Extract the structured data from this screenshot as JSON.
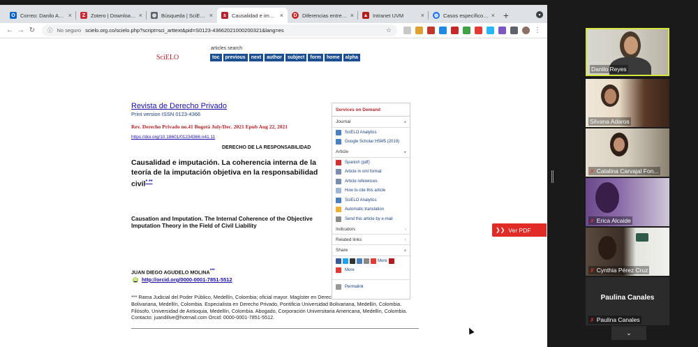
{
  "tabs": [
    {
      "title": "Correo: Danilo Andrés Reyes",
      "icon_color": "#0a64c8",
      "icon": "outlook-icon"
    },
    {
      "title": "Zotero | Downloads",
      "icon_color": "#cc2936",
      "icon": "zotero-icon"
    },
    {
      "title": "Búsqueda | SciELO",
      "icon_color": "#5f6368",
      "icon": "globe-icon"
    },
    {
      "title": "Causalidad e imputación",
      "icon_color": "#b4232a",
      "icon": "scielo-icon",
      "active": true
    },
    {
      "title": "Diferencias entre el dolo",
      "icon_color": "#c62828",
      "icon": "d-icon"
    },
    {
      "title": "Intranet UVM",
      "icon_color": "#b71c1c",
      "icon": "uvm-icon"
    },
    {
      "title": "Casos específicos de",
      "icon_color": "#1a73e8",
      "icon": "globe-icon"
    }
  ],
  "close_glyph": "×",
  "new_tab_glyph": "+",
  "address": {
    "security": "No seguro",
    "url": "scielo.org.co/scielo.php?script=sci_arttext&pid=S0123-43662021000200321&lang=es"
  },
  "page": {
    "logo": "SciELO",
    "nav_label": "articles search",
    "nav_items": [
      "toc",
      "previous",
      "next",
      "author",
      "subject",
      "form",
      "home",
      "alpha"
    ],
    "journal": "Revista de Derecho Privado",
    "issn": "Print version ISSN 0123-4366",
    "issue": "Rev. Derecho Privado  no.41 Bogotá July/Dec. 2021  Epub Aug 22, 2021",
    "doi": "https://doi.org/10.18601/01234366.n41.11",
    "section": "DERECHO DE LA RESPONSABILIDAD",
    "title_es": "Causalidad e imputación. La coherencia interna de la teoría de la imputación objetiva en la responsabilidad civil",
    "title_es_marks": "* **",
    "title_en": "Causation and Imputation. The Internal Coherence of the Objective Imputation Theory in the Field of Civil Liability",
    "author": "JUAN DIEGO AGUDELO MOLINA",
    "author_marks": "***",
    "orcid": "http://orcid.org/0000-0001-7851-5512",
    "affiliation": "*** Rama Judicial del Poder Público, Medellín, Colombia; oficial mayor. Magíster en Derecho, Pontificia Universidad Bolivariana, Medellín, Colombia. Especialista en Derecho Privado, Pontificia Universidad Bolivariana, Medellín, Colombia. Filósofo, Universidad de Antioquia, Medellín, Colombia. Abogado, Corporación Universitaria Americana, Medellín, Colombia. Contacto: juandilive@hotmail.com Orcid: 0000-0001-7851-5512."
  },
  "sidebox": {
    "header": "Services on Demand",
    "journal_label": "Journal",
    "journal_items": [
      "SciELO Analytics",
      "Google Scholar H5M5 (2019)"
    ],
    "article_label": "Article",
    "article_items": [
      "Spanish (pdf)",
      "Article in xml format",
      "Article references",
      "How to cite this article",
      "SciELO Analytics",
      "Automatic translation",
      "Send this article by e-mail"
    ],
    "indicators_label": "Indicators",
    "related_label": "Related links",
    "share_label": "Share",
    "share_more": "More",
    "more_label": "More",
    "permalink": "Permalink"
  },
  "ver_pdf": "Ver PDF",
  "participants": [
    {
      "name": "Danilo Reyes",
      "muted": false,
      "active": true
    },
    {
      "name": "Silvana Adaros",
      "muted": false
    },
    {
      "name": "Catalina Carvajal Fon...",
      "muted": true
    },
    {
      "name": "Erica Alcaide",
      "muted": true
    },
    {
      "name": "Cynthia Pérez Cruz",
      "muted": true
    },
    {
      "name": "Paulina Canales",
      "muted": true,
      "video_off": true
    }
  ],
  "colors": {
    "accent_red": "#e02b27",
    "active_speaker": "#d6e63a",
    "link_blue": "#1a0dab",
    "scielo_red": "#b4232a",
    "nav_blue": "#1b4f91"
  }
}
